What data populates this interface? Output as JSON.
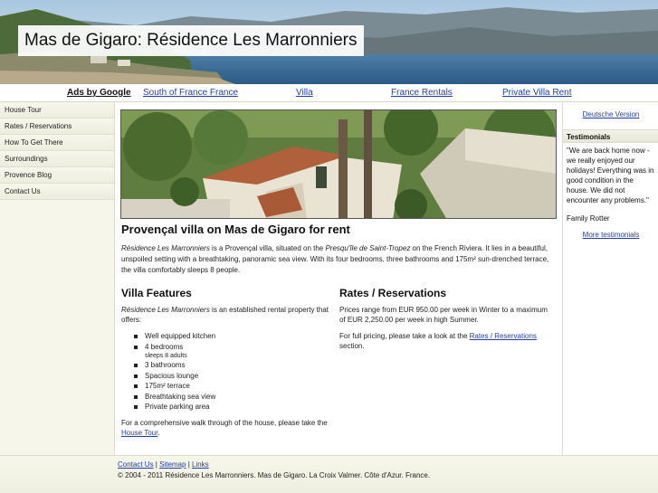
{
  "header": {
    "site_title": "Mas de Gigaro: Résidence Les Marronniers"
  },
  "adsbar": {
    "label": "Ads by Google",
    "links": [
      "South of France France",
      "Villa",
      "France Rentals",
      "Private Villa Rent"
    ]
  },
  "leftnav": {
    "items": [
      "House Tour",
      "Rates / Reservations",
      "How To Get There",
      "Surroundings",
      "Provence Blog",
      "Contact Us"
    ]
  },
  "main": {
    "heading": "Provençal villa on Mas de Gigaro for rent",
    "intro": {
      "name": "Résidence Les Marronniers",
      "part1": " is a Provençal villa, situated on the ",
      "place": "Presqu'île de Saint-Tropez",
      "part2": " on the French Riviera. It lies in a beautiful, unspoiled setting with a breathtaking, panoramic sea view. With its four bedrooms, three bathrooms and 175m² sun-drenched terrace, the villa comfortably sleeps 8 people."
    },
    "features": {
      "heading": "Villa Features",
      "intro_name": "Résidence Les Marronniers",
      "intro_text": " is an established rental property that offers:",
      "items": [
        "Well equipped kitchen",
        "4 bedrooms",
        "3 bathrooms",
        "Spacious lounge",
        "175m² terrace",
        "Breathtaking sea view",
        "Private parking area"
      ],
      "bedrooms_note": "sleeps 8 adults",
      "walkthrough_text": "For a comprehensive walk through of the house, please take the ",
      "walkthrough_link": "House Tour",
      "walkthrough_end": "."
    },
    "rates": {
      "heading": "Rates / Reservations",
      "prices": "Prices range from EUR 950.00 per week in Winter to a maximum of EUR 2,250.00 per week in high Summer.",
      "pricing_text": "For full pricing, please take a look at the ",
      "pricing_link": "Rates / Reservations",
      "pricing_end": " section."
    }
  },
  "rightbar": {
    "language_link": "Deutsche Version",
    "testimonials_title": "Testimonials",
    "quote": "\"We are back home now - we really enjoyed our holidays! Everything was in good condition in the house. We did not encounter any problems.\"",
    "quote_author": "Family Rotter",
    "more_link": "More testimonials"
  },
  "footer": {
    "links": [
      "Contact Us",
      "Sitemap",
      "Links"
    ],
    "separator": " | ",
    "copyright": "© 2004 - 2011 Résidence Les Marronniers. Mas de Gigaro. La Croix Valmer. Côte d'Azur. France."
  },
  "colors": {
    "link": "#1f3fb0",
    "nav_background": "#f6f6ea",
    "sea": "#3a6f98"
  }
}
